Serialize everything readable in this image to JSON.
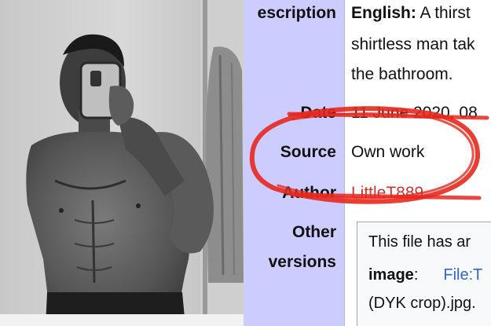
{
  "photo": {
    "alt": ""
  },
  "table": {
    "rows": [
      {
        "label": "escription",
        "value_bold": "English:",
        "value_text": " A thirst",
        "cont1": "shirtless man tak",
        "cont2": "the bathroom."
      },
      {
        "label": "Date",
        "value": "11 June 2020, 08"
      },
      {
        "label": "Source",
        "value": "Own work"
      },
      {
        "label": "Author",
        "value": "LittleT889"
      },
      {
        "label1": "Other",
        "label2": "versions",
        "box_line1": "This file has ar",
        "box_image_label": "image",
        "box_colon": ":",
        "box_link1": "File:T",
        "box_link2": "(DYK crop).jpg."
      }
    ]
  },
  "colors": {
    "label_bg": "#ccccff",
    "circle": "#e8281e",
    "author_link": "#d33333",
    "file_link": "#3366cc"
  }
}
